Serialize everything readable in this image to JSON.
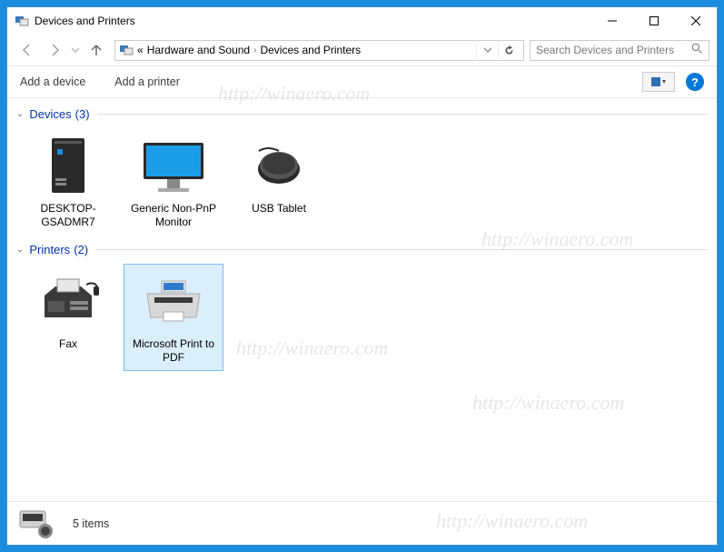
{
  "title": "Devices and Printers",
  "breadcrumb": {
    "prefix": "«",
    "parent": "Hardware and Sound",
    "current": "Devices and Printers"
  },
  "search": {
    "placeholder": "Search Devices and Printers"
  },
  "toolbar": {
    "add_device": "Add a device",
    "add_printer": "Add a printer"
  },
  "groups": [
    {
      "key": "devices",
      "name": "Devices",
      "count": "(3)",
      "items": [
        {
          "id": "desktop",
          "label": "DESKTOP-GSADMR7",
          "icon": "pc",
          "selected": false
        },
        {
          "id": "monitor",
          "label": "Generic Non-PnP Monitor",
          "icon": "monitor",
          "selected": false
        },
        {
          "id": "tablet",
          "label": "USB Tablet",
          "icon": "mouse",
          "selected": false
        }
      ]
    },
    {
      "key": "printers",
      "name": "Printers",
      "count": "(2)",
      "items": [
        {
          "id": "fax",
          "label": "Fax",
          "icon": "fax",
          "selected": false
        },
        {
          "id": "pdf",
          "label": "Microsoft Print to PDF",
          "icon": "printer",
          "selected": true
        }
      ]
    }
  ],
  "status": {
    "text": "5 items"
  },
  "watermark": "http://winaero.com"
}
